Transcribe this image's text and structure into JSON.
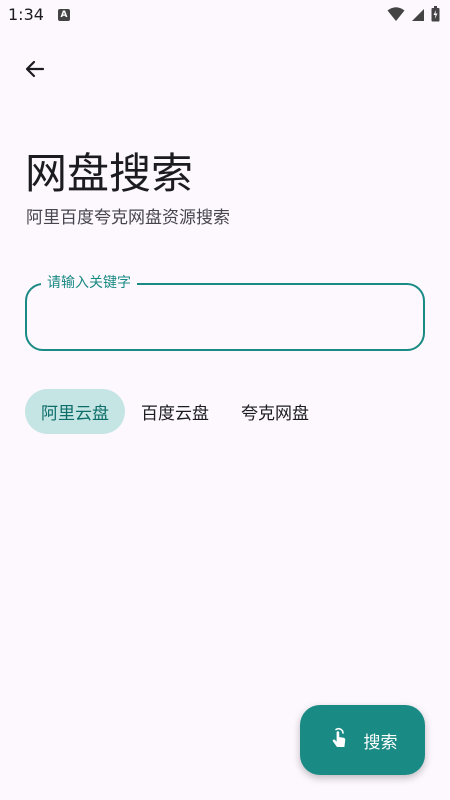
{
  "status_bar": {
    "time": "1:34",
    "notification_glyph": "A",
    "icons": [
      "wifi-icon",
      "signal-icon",
      "battery-icon"
    ]
  },
  "header": {
    "back_icon": "arrow-left-icon"
  },
  "main": {
    "title": "网盘搜索",
    "subtitle": "阿里百度夸克网盘资源搜索",
    "search": {
      "label": "请输入关键字",
      "value": "",
      "placeholder": ""
    },
    "chips": [
      {
        "label": "阿里云盘",
        "selected": true
      },
      {
        "label": "百度云盘",
        "selected": false
      },
      {
        "label": "夸克网盘",
        "selected": false
      }
    ]
  },
  "fab": {
    "icon": "touch-icon",
    "label": "搜索"
  },
  "colors": {
    "background": "#fcf8fe",
    "accent": "#1a8a84",
    "chip_selected_bg": "#c5e4e4",
    "chip_selected_text": "#0d6e69",
    "text_primary": "#1c1b1f",
    "text_secondary": "#49454f"
  }
}
